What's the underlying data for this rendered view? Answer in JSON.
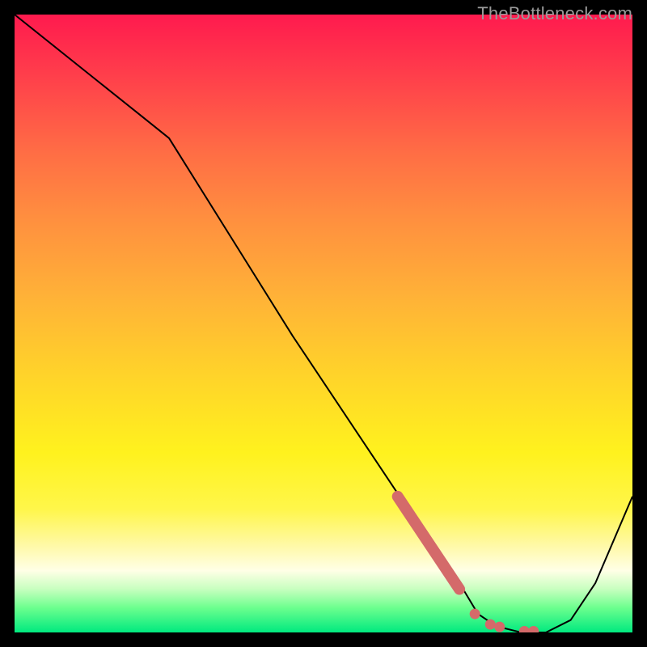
{
  "watermark": "TheBottleneck.com",
  "colors": {
    "curve": "#000000",
    "marker": "#d46a6a"
  },
  "chart_data": {
    "type": "line",
    "title": "",
    "xlabel": "",
    "ylabel": "",
    "xlim": [
      0,
      100
    ],
    "ylim": [
      0,
      100
    ],
    "x": [
      0,
      10,
      20,
      25,
      35,
      45,
      55,
      65,
      72,
      75,
      78,
      82,
      86,
      90,
      94,
      100
    ],
    "values": [
      100,
      92,
      84,
      80,
      64,
      48,
      33,
      18,
      8,
      3,
      1,
      0,
      0,
      2,
      8,
      22
    ],
    "markers": {
      "bar": {
        "x1": 62,
        "y1": 22,
        "x2": 72,
        "y2": 7
      },
      "dots": [
        {
          "x": 74.5,
          "y": 3.0
        },
        {
          "x": 77.0,
          "y": 1.3
        },
        {
          "x": 78.5,
          "y": 0.9
        },
        {
          "x": 82.5,
          "y": 0.2
        },
        {
          "x": 84.0,
          "y": 0.2
        }
      ]
    }
  }
}
